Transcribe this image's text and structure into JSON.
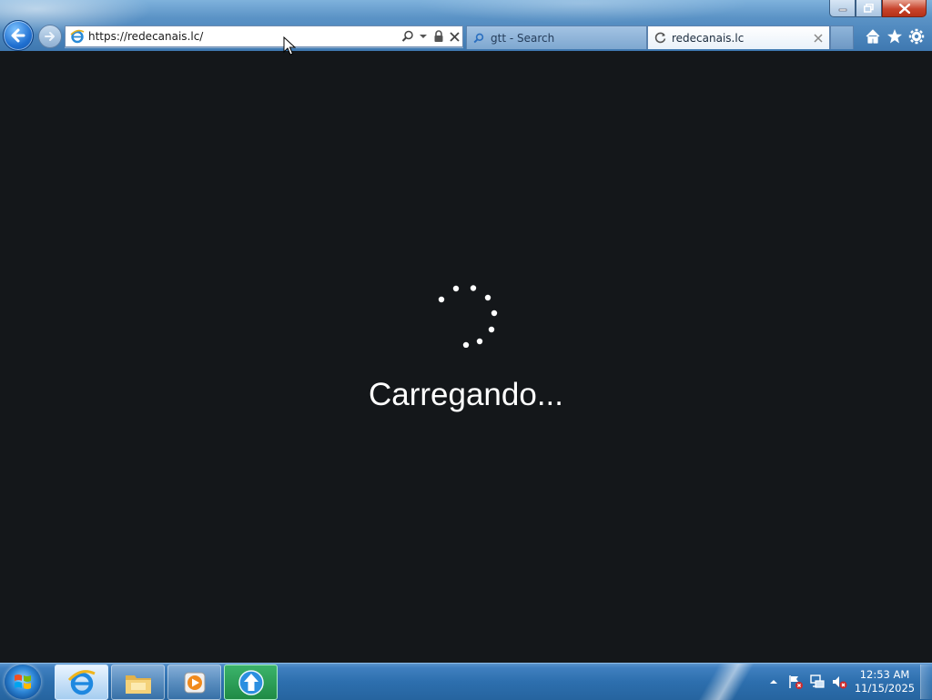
{
  "window": {
    "minimize_icon": "minimize-icon",
    "restore_icon": "restore-icon",
    "close_icon": "close-icon"
  },
  "browser": {
    "back_icon": "back-arrow-icon",
    "forward_icon": "forward-arrow-icon",
    "address": "https://redecanais.lc/",
    "address_favicon": "ie-page-icon",
    "address_buttons": [
      "search-icon",
      "dropdown-icon",
      "lock-icon",
      "stop-icon"
    ],
    "tabs": [
      {
        "label": "gtt - Search",
        "icon": "search-icon",
        "active": false
      },
      {
        "label": "redecanais.lc",
        "icon": "loading-icon",
        "active": true
      }
    ],
    "command_icons": [
      "home-icon",
      "favorites-star-icon",
      "tools-gear-icon"
    ]
  },
  "page": {
    "loading_text": "Carregando...",
    "background": "#14171a"
  },
  "taskbar": {
    "start_icon": "windows-start-icon",
    "pinned": [
      {
        "name": "internet-explorer",
        "icon": "ie-icon",
        "state": "active"
      },
      {
        "name": "file-explorer",
        "icon": "folder-icon",
        "state": "normal"
      },
      {
        "name": "media-player",
        "icon": "media-player-icon",
        "state": "normal"
      },
      {
        "name": "update-app",
        "icon": "upload-arrow-icon",
        "state": "highlighted"
      }
    ],
    "tray_icons": [
      "show-hidden-icons-arrow",
      "action-center-flag-icon",
      "network-icon",
      "volume-muted-icon"
    ],
    "clock_time": "12:53 AM",
    "clock_date": "11/15/2025"
  }
}
